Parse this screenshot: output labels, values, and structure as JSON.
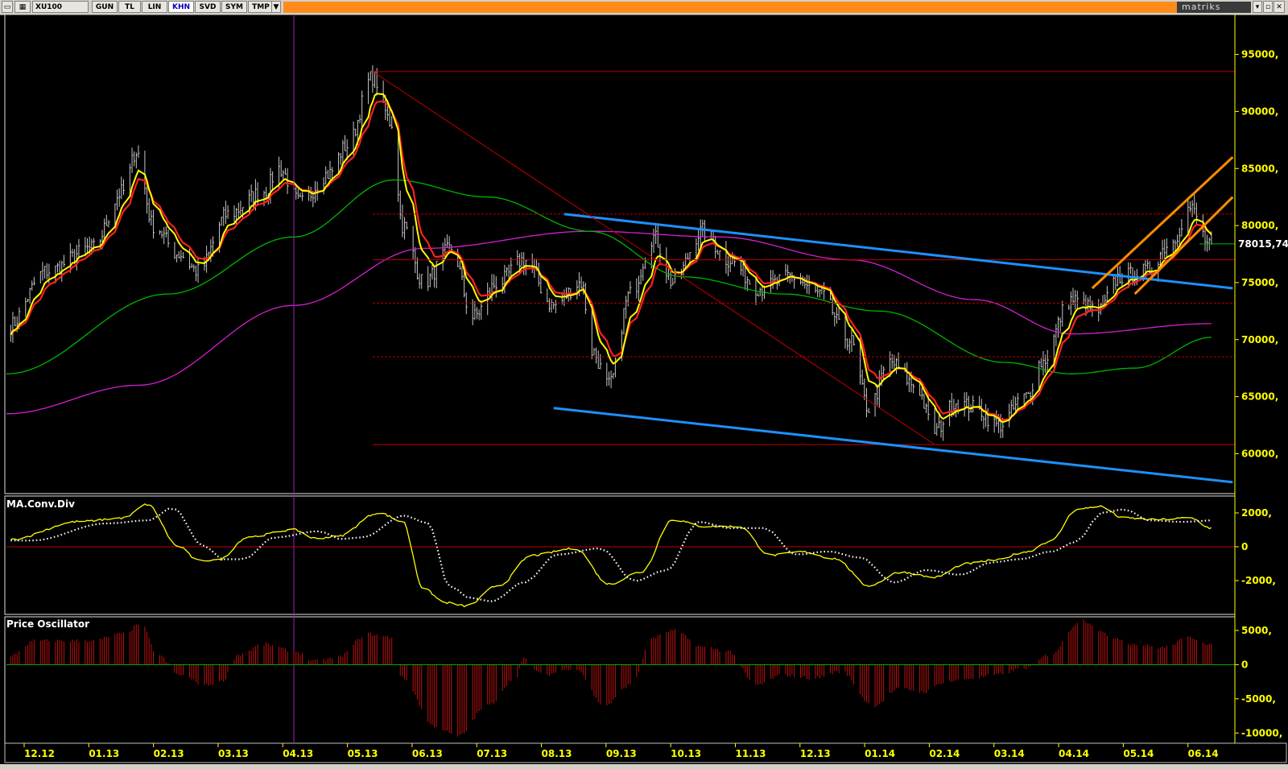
{
  "toolbar": {
    "symbol": "XU100",
    "buttons": [
      "GUN",
      "TL",
      "LIN",
      "KHN",
      "SVD",
      "SYM",
      "TMP"
    ],
    "active": "KHN",
    "brand": "matriks"
  },
  "colors": {
    "bars": "#c8c8c8",
    "ma_fast": "#ffff00",
    "ma_slow": "#ff2020",
    "ma_mid": "#00b400",
    "ma_long": "#d020d0",
    "channel_blue": "#1e90ff",
    "channel_orange": "#ff8c00",
    "fib": "#c00000",
    "axis_text": "#ffff00"
  },
  "chart_data": [
    {
      "type": "line",
      "panel": "price",
      "y_tick_labels": [
        "95000,",
        "90000,",
        "85000,",
        "80000,",
        "75000,",
        "70000,",
        "65000,",
        "60000,"
      ],
      "y_ticks": [
        95000,
        90000,
        85000,
        80000,
        75000,
        70000,
        65000,
        60000
      ],
      "ylim": [
        56500,
        98500
      ],
      "x_tick_labels": [
        "12.12",
        "01.13",
        "02.13",
        "03.13",
        "04.13",
        "05.13",
        "06.13",
        "07.13",
        "08.13",
        "09.13",
        "10.13",
        "11.13",
        "12.13",
        "01.14",
        "02.14",
        "03.14",
        "04.14",
        "05.14",
        "06.14"
      ],
      "last_value_label": "78015,74",
      "close_anchors": [
        [
          "2012-12-01",
          71000
        ],
        [
          "2012-12-20",
          76000
        ],
        [
          "2013-01-10",
          78000
        ],
        [
          "2013-01-25",
          83000
        ],
        [
          "2013-01-31",
          86500
        ],
        [
          "2013-02-08",
          80000
        ],
        [
          "2013-02-20",
          77500
        ],
        [
          "2013-03-01",
          76000
        ],
        [
          "2013-03-15",
          81000
        ],
        [
          "2013-04-01",
          83000
        ],
        [
          "2013-04-08",
          85000
        ],
        [
          "2013-04-18",
          82000
        ],
        [
          "2013-05-01",
          84500
        ],
        [
          "2013-05-10",
          87000
        ],
        [
          "2013-05-22",
          93000
        ],
        [
          "2013-05-31",
          89000
        ],
        [
          "2013-06-05",
          80000
        ],
        [
          "2013-06-15",
          75000
        ],
        [
          "2013-06-28",
          78000
        ],
        [
          "2013-07-08",
          72000
        ],
        [
          "2013-07-20",
          75000
        ],
        [
          "2013-08-01",
          77000
        ],
        [
          "2013-08-15",
          73000
        ],
        [
          "2013-08-28",
          75000
        ],
        [
          "2013-09-02",
          69000
        ],
        [
          "2013-09-10",
          66000
        ],
        [
          "2013-09-20",
          74000
        ],
        [
          "2013-10-01",
          79000
        ],
        [
          "2013-10-10",
          75000
        ],
        [
          "2013-10-24",
          79500
        ],
        [
          "2013-11-05",
          77000
        ],
        [
          "2013-11-20",
          74500
        ],
        [
          "2013-12-05",
          75500
        ],
        [
          "2013-12-18",
          74000
        ],
        [
          "2014-01-01",
          70000
        ],
        [
          "2014-01-10",
          64000
        ],
        [
          "2014-01-20",
          68000
        ],
        [
          "2014-02-01",
          66000
        ],
        [
          "2014-02-10",
          62000
        ],
        [
          "2014-02-20",
          64500
        ],
        [
          "2014-03-01",
          64000
        ],
        [
          "2014-03-12",
          62500
        ],
        [
          "2014-03-25",
          65000
        ],
        [
          "2014-04-01",
          68000
        ],
        [
          "2014-04-15",
          73500
        ],
        [
          "2014-04-28",
          72500
        ],
        [
          "2014-05-08",
          75500
        ],
        [
          "2014-05-20",
          76000
        ],
        [
          "2014-06-01",
          78500
        ],
        [
          "2014-06-10",
          81500
        ],
        [
          "2014-06-20",
          78015
        ]
      ],
      "ma_long_anchors": [
        [
          "2012-12-01",
          63500
        ],
        [
          "2013-02-01",
          66000
        ],
        [
          "2013-04-15",
          73000
        ],
        [
          "2013-06-15",
          78000
        ],
        [
          "2013-09-01",
          79500
        ],
        [
          "2013-11-01",
          79000
        ],
        [
          "2014-01-01",
          77000
        ],
        [
          "2014-03-01",
          73500
        ],
        [
          "2014-04-15",
          70500
        ],
        [
          "2014-06-20",
          71400
        ]
      ],
      "ma_mid_anchors": [
        [
          "2012-12-01",
          67000
        ],
        [
          "2013-02-15",
          74000
        ],
        [
          "2013-04-15",
          79000
        ],
        [
          "2013-06-01",
          84000
        ],
        [
          "2013-07-15",
          82500
        ],
        [
          "2013-09-01",
          79500
        ],
        [
          "2013-10-15",
          75500
        ],
        [
          "2013-12-01",
          74000
        ],
        [
          "2014-01-15",
          72500
        ],
        [
          "2014-03-15",
          68000
        ],
        [
          "2014-04-15",
          67000
        ],
        [
          "2014-05-15",
          67500
        ],
        [
          "2014-06-20",
          70200
        ]
      ],
      "fib_levels": [
        93500,
        81000,
        77000,
        73200,
        68500,
        60800
      ],
      "fib_range": [
        "2013-05-22",
        "2014-06-30"
      ],
      "trendlines": [
        {
          "color": "channel_blue",
          "points": [
            [
              "2013-08-20",
              81000
            ],
            [
              "2014-06-30",
              74500
            ]
          ]
        },
        {
          "color": "channel_blue",
          "points": [
            [
              "2013-08-15",
              64000
            ],
            [
              "2014-06-30",
              57500
            ]
          ]
        },
        {
          "color": "channel_orange",
          "points": [
            [
              "2014-04-25",
              74500
            ],
            [
              "2014-06-30",
              86000
            ]
          ]
        },
        {
          "color": "channel_orange",
          "points": [
            [
              "2014-05-15",
              74000
            ],
            [
              "2014-06-30",
              82500
            ]
          ]
        },
        {
          "color": "fib",
          "points": [
            [
              "2013-05-22",
              93500
            ],
            [
              "2014-02-10",
              60800
            ]
          ]
        }
      ],
      "vertical_marker": "2013-04-15"
    },
    {
      "type": "line",
      "panel": "macd",
      "title": "MA.Conv.Div",
      "y_tick_labels": [
        "2000,",
        "0",
        "-2000,"
      ],
      "y_ticks": [
        2000,
        0,
        -2000
      ],
      "ylim": [
        -4000,
        3000
      ],
      "series_anchors": [
        [
          "2012-12-01",
          400
        ],
        [
          "2013-01-05",
          1500
        ],
        [
          "2013-01-25",
          1700
        ],
        [
          "2013-02-05",
          2500
        ],
        [
          "2013-02-20",
          0
        ],
        [
          "2013-03-01",
          -800
        ],
        [
          "2013-03-10",
          -800
        ],
        [
          "2013-03-25",
          600
        ],
        [
          "2013-04-15",
          1000
        ],
        [
          "2013-04-25",
          500
        ],
        [
          "2013-05-05",
          600
        ],
        [
          "2013-05-25",
          2000
        ],
        [
          "2013-06-05",
          1500
        ],
        [
          "2013-06-15",
          -2500
        ],
        [
          "2013-06-25",
          -3300
        ],
        [
          "2013-07-05",
          -3500
        ],
        [
          "2013-07-20",
          -2300
        ],
        [
          "2013-08-05",
          -500
        ],
        [
          "2013-08-25",
          -100
        ],
        [
          "2013-09-10",
          -2200
        ],
        [
          "2013-09-25",
          -1500
        ],
        [
          "2013-10-10",
          1600
        ],
        [
          "2013-10-25",
          1200
        ],
        [
          "2013-11-10",
          1200
        ],
        [
          "2013-11-25",
          -500
        ],
        [
          "2013-12-10",
          -300
        ],
        [
          "2013-12-25",
          -700
        ],
        [
          "2014-01-10",
          -2300
        ],
        [
          "2014-01-25",
          -1500
        ],
        [
          "2014-02-10",
          -1800
        ],
        [
          "2014-02-25",
          -1000
        ],
        [
          "2014-03-10",
          -800
        ],
        [
          "2014-03-25",
          -300
        ],
        [
          "2014-04-05",
          300
        ],
        [
          "2014-04-18",
          2200
        ],
        [
          "2014-04-28",
          2400
        ],
        [
          "2014-05-10",
          1700
        ],
        [
          "2014-05-25",
          1600
        ],
        [
          "2014-06-10",
          1700
        ],
        [
          "2014-06-20",
          1100
        ]
      ],
      "signal_lag_days": 12
    },
    {
      "type": "bar",
      "panel": "oscillator",
      "title": "Price Oscillator",
      "y_tick_labels": [
        "5000,",
        "0",
        "-5000,",
        "-10000,"
      ],
      "y_ticks": [
        5000,
        0,
        -5000,
        -10000
      ],
      "ylim": [
        -11500,
        7000
      ],
      "series_anchors": [
        [
          "2012-12-01",
          1000
        ],
        [
          "2012-12-15",
          3500
        ],
        [
          "2013-01-10",
          3500
        ],
        [
          "2013-01-25",
          4500
        ],
        [
          "2013-02-02",
          6000
        ],
        [
          "2013-02-10",
          1500
        ],
        [
          "2013-02-20",
          -1500
        ],
        [
          "2013-03-05",
          -3000
        ],
        [
          "2013-03-12",
          -2500
        ],
        [
          "2013-03-20",
          1500
        ],
        [
          "2013-04-01",
          3000
        ],
        [
          "2013-04-15",
          2000
        ],
        [
          "2013-04-25",
          500
        ],
        [
          "2013-05-05",
          1000
        ],
        [
          "2013-05-20",
          4500
        ],
        [
          "2013-05-31",
          4000
        ],
        [
          "2013-06-05",
          -2000
        ],
        [
          "2013-06-20",
          -9000
        ],
        [
          "2013-07-01",
          -10500
        ],
        [
          "2013-07-15",
          -6000
        ],
        [
          "2013-07-28",
          -2000
        ],
        [
          "2013-08-01",
          800
        ],
        [
          "2013-08-10",
          -1500
        ],
        [
          "2013-08-25",
          -500
        ],
        [
          "2013-09-08",
          -6000
        ],
        [
          "2013-09-20",
          -3000
        ],
        [
          "2013-10-01",
          4000
        ],
        [
          "2013-10-10",
          5000
        ],
        [
          "2013-10-25",
          2500
        ],
        [
          "2013-11-05",
          2000
        ],
        [
          "2013-11-18",
          -3000
        ],
        [
          "2013-12-01",
          -1500
        ],
        [
          "2013-12-15",
          -2000
        ],
        [
          "2013-12-28",
          -1000
        ],
        [
          "2014-01-12",
          -6000
        ],
        [
          "2014-01-25",
          -3500
        ],
        [
          "2014-02-05",
          -4000
        ],
        [
          "2014-02-15",
          -2500
        ],
        [
          "2014-02-28",
          -2000
        ],
        [
          "2014-03-10",
          -1500
        ],
        [
          "2014-03-25",
          -500
        ],
        [
          "2014-04-05",
          1500
        ],
        [
          "2014-04-20",
          6500
        ],
        [
          "2014-05-05",
          4000
        ],
        [
          "2014-05-15",
          3000
        ],
        [
          "2014-05-28",
          2500
        ],
        [
          "2014-06-10",
          4000
        ],
        [
          "2014-06-20",
          3000
        ]
      ]
    }
  ]
}
